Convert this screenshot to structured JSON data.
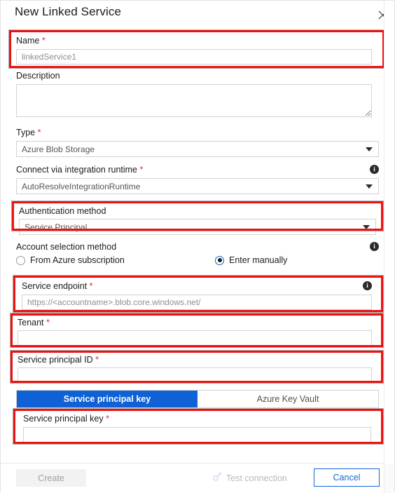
{
  "dialog": {
    "title": "New Linked Service",
    "close_icon": "close-icon"
  },
  "fields": {
    "name": {
      "label": "Name",
      "required_marker": "*",
      "value": "linkedService1",
      "placeholder": "linkedService1"
    },
    "description": {
      "label": "Description",
      "value": "",
      "placeholder": ""
    },
    "type": {
      "label": "Type",
      "required_marker": "*",
      "value": "Azure Blob Storage"
    },
    "integration_runtime": {
      "label": "Connect via integration runtime",
      "required_marker": "*",
      "value": "AutoResolveIntegrationRuntime",
      "info_icon": "info-icon"
    },
    "auth_method": {
      "label": "Authentication method",
      "value": "Service Principal"
    },
    "account_selection": {
      "label": "Account selection method",
      "info_icon": "info-icon",
      "options": [
        {
          "label": "From Azure subscription",
          "selected": false
        },
        {
          "label": "Enter manually",
          "selected": true
        }
      ]
    },
    "service_endpoint": {
      "label": "Service endpoint",
      "required_marker": "*",
      "value": "",
      "placeholder": "https://<accountname>.blob.core.windows.net/",
      "info_icon": "info-icon"
    },
    "tenant": {
      "label": "Tenant",
      "required_marker": "*",
      "value": "",
      "placeholder": ""
    },
    "service_principal_id": {
      "label": "Service principal ID",
      "required_marker": "*",
      "value": "",
      "placeholder": ""
    },
    "credential_tabs": [
      {
        "label": "Service principal key",
        "active": true
      },
      {
        "label": "Azure Key Vault",
        "active": false
      }
    ],
    "service_principal_key": {
      "label": "Service principal key",
      "required_marker": "*",
      "value": "",
      "placeholder": ""
    }
  },
  "footer": {
    "create_label": "Create",
    "test_connection_label": "Test connection",
    "test_connection_icon": "plug-icon",
    "cancel_label": "Cancel"
  },
  "colors": {
    "highlight": "#ee1111",
    "accent_blue": "#0f62d6",
    "cancel_blue": "#1565d8",
    "required_red": "#d13438"
  }
}
